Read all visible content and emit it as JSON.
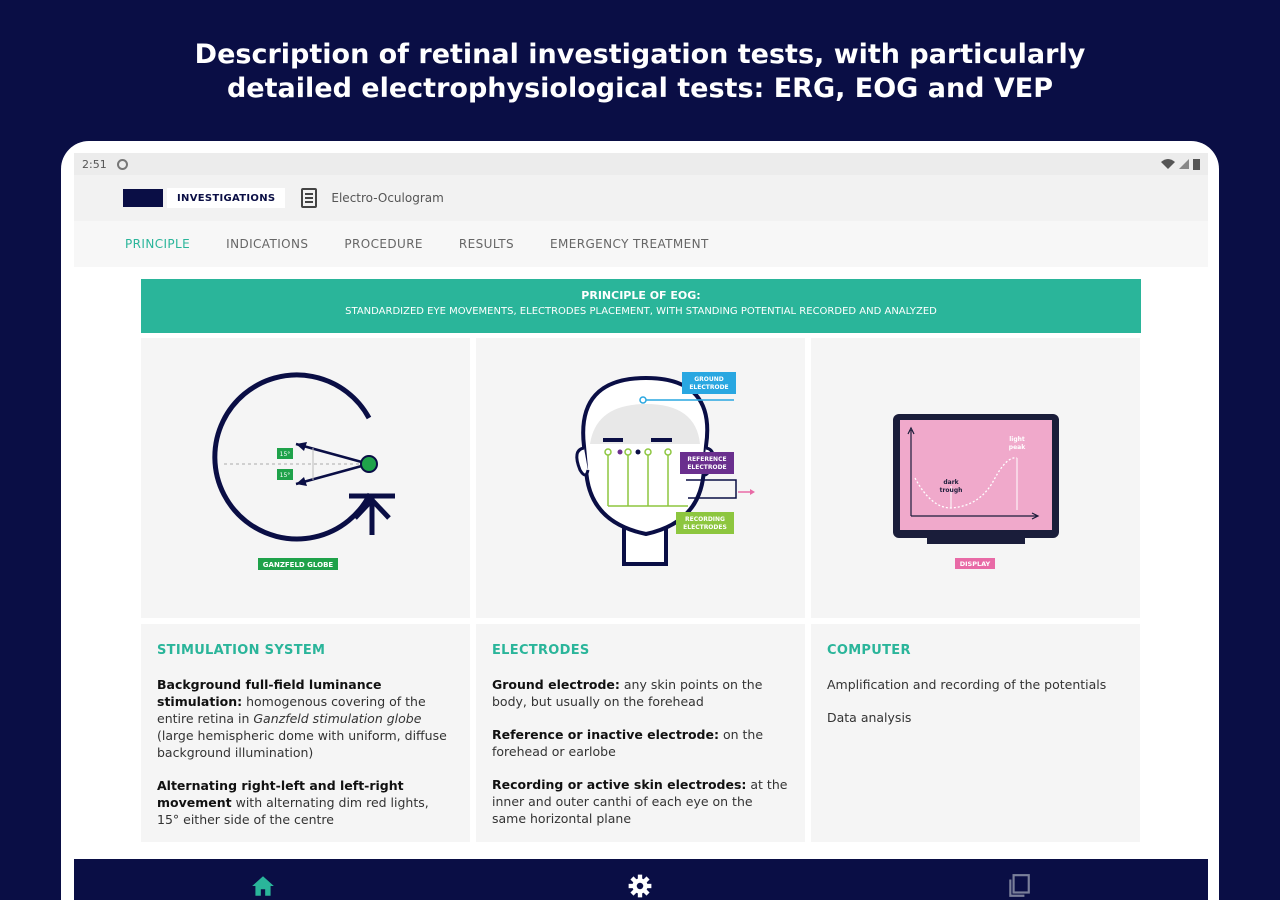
{
  "headline": {
    "line1": "Description of retinal investigation tests, with particularly",
    "line2": "detailed electrophysiological tests: ERG, EOG and VEP"
  },
  "statusbar": {
    "time": "2:51"
  },
  "appbar": {
    "chip_label": "INVESTIGATIONS",
    "breadcrumb": "Electro-Oculogram"
  },
  "tabs": [
    {
      "label": "PRINCIPLE",
      "active": true
    },
    {
      "label": "INDICATIONS"
    },
    {
      "label": "PROCEDURE"
    },
    {
      "label": "RESULTS"
    },
    {
      "label": "EMERGENCY TREATMENT"
    }
  ],
  "banner": {
    "title": "PRINCIPLE OF EOG:",
    "subtitle": "STANDARDIZED EYE MOVEMENTS, ELECTRODES PLACEMENT, WITH STANDING POTENTIAL RECORDED AND ANALYZED"
  },
  "illustrations": {
    "globe": {
      "label": "GANZFELD GLOBE",
      "marker": "15°"
    },
    "head": {
      "ground": [
        "GROUND",
        "ELECTRODE"
      ],
      "reference": [
        "REFERENCE",
        "ELECTRODE"
      ],
      "recording": [
        "RECORDING",
        "ELECTRODES"
      ]
    },
    "display": {
      "label": "DISPLAY",
      "peak": [
        "light",
        "peak"
      ],
      "trough": [
        "dark",
        "trough"
      ]
    }
  },
  "columns": {
    "stim": {
      "heading": "STIMULATION SYSTEM",
      "p1_bold": "Background full-field luminance stimulation:",
      "p1_text": " homogenous covering of the entire retina in ",
      "p1_italic": "Ganzfeld stimulation globe",
      "p1_rest": " (large hemispheric dome with uniform, diffuse background illumination)",
      "p2_bold": "Alternating right-left and left-right movement",
      "p2_text": " with alternating dim red lights, 15° either side of the centre"
    },
    "elec": {
      "heading": "ELECTRODES",
      "p1_bold": "Ground electrode:",
      "p1_text": " any skin points on the body, but usually on the forehead",
      "p2_bold": "Reference or inactive electrode:",
      "p2_text": " on the forehead or earlobe",
      "p3_bold": "Recording or active skin electrodes:",
      "p3_text": " at the inner and outer canthi of each eye on the same horizontal plane"
    },
    "comp": {
      "heading": "COMPUTER",
      "p1": "Amplification and recording of the potentials",
      "p2": "Data analysis"
    }
  },
  "bottom_nav": [
    {
      "icon": "home-icon",
      "color": "#2ab59a"
    },
    {
      "icon": "gear-icon",
      "color": "#ffffff"
    },
    {
      "icon": "pages-icon",
      "color": "#7a7f9a"
    }
  ],
  "colors": {
    "navy": "#0a0e45",
    "teal": "#2ab59a",
    "green": "#1fa24a",
    "blue": "#29a7e1",
    "purple": "#6a2f8e",
    "lime": "#8dc63f",
    "pink": "#e86aa6"
  }
}
